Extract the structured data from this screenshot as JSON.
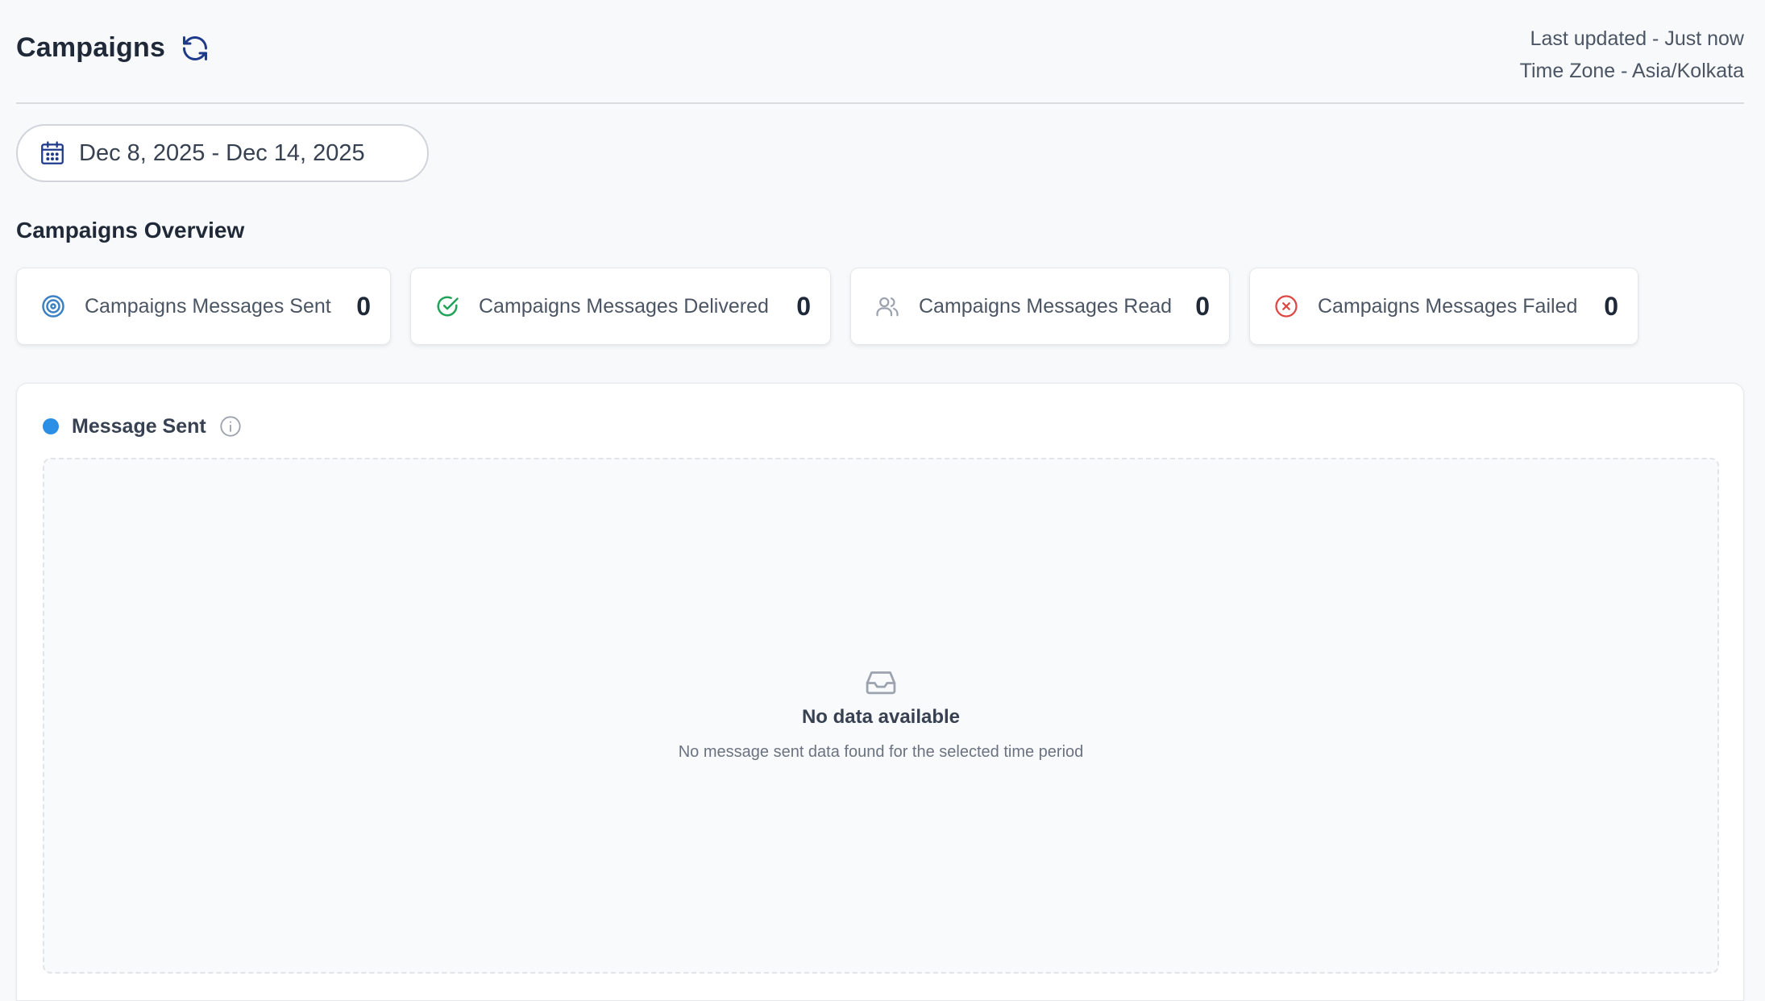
{
  "header": {
    "title": "Campaigns",
    "last_updated": "Last updated - Just now",
    "time_zone": "Time Zone - Asia/Kolkata"
  },
  "date_range": {
    "label": "Dec 8, 2025 - Dec 14, 2025"
  },
  "overview": {
    "title": "Campaigns Overview",
    "stats": [
      {
        "label": "Campaigns Messages Sent",
        "value": "0",
        "icon": "target-icon",
        "color": "#3b82c4"
      },
      {
        "label": "Campaigns Messages Delivered",
        "value": "0",
        "icon": "check-circle-icon",
        "color": "#22a35a"
      },
      {
        "label": "Campaigns Messages Read",
        "value": "0",
        "icon": "users-icon",
        "color": "#9ca3af"
      },
      {
        "label": "Campaigns Messages Failed",
        "value": "0",
        "icon": "x-circle-icon",
        "color": "#e04545"
      }
    ]
  },
  "chart": {
    "legend_label": "Message Sent",
    "legend_color": "#2b8fe6",
    "empty_title": "No data available",
    "empty_description": "No message sent data found for the selected time period"
  },
  "colors": {
    "accent": "#1e3a8a",
    "background": "#f8f9fa"
  }
}
